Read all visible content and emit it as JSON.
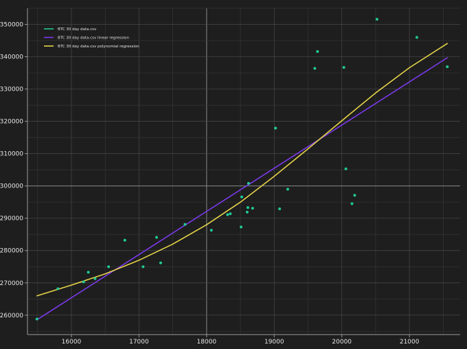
{
  "chart_data": {
    "type": "scatter",
    "title": "",
    "xlabel": "",
    "ylabel": "",
    "xlim": [
      15350,
      21750
    ],
    "ylim": [
      254000,
      355000
    ],
    "x_ticks": [
      16000,
      17000,
      18000,
      19000,
      20000,
      21000
    ],
    "y_ticks": [
      260000,
      270000,
      280000,
      290000,
      300000,
      310000,
      320000,
      330000,
      340000,
      350000
    ],
    "highlight_gridlines": {
      "x": 18000,
      "y": 300000
    },
    "grid": true,
    "legend_position": "top-left",
    "background_color": "#1e1e1e",
    "series": [
      {
        "name": "BTC 30 day data.csv",
        "kind": "scatter",
        "color": "#20c997",
        "points": [
          [
            15490,
            258800
          ],
          [
            15800,
            268200
          ],
          [
            16180,
            270300
          ],
          [
            16250,
            273300
          ],
          [
            16350,
            271300
          ],
          [
            16550,
            275000
          ],
          [
            16790,
            283200
          ],
          [
            17060,
            275000
          ],
          [
            17260,
            284100
          ],
          [
            17320,
            276200
          ],
          [
            17680,
            288100
          ],
          [
            18070,
            286300
          ],
          [
            18310,
            291100
          ],
          [
            18350,
            291400
          ],
          [
            18510,
            287300
          ],
          [
            18520,
            296600
          ],
          [
            18600,
            291900
          ],
          [
            18610,
            293300
          ],
          [
            18620,
            300800
          ],
          [
            18680,
            293100
          ],
          [
            19020,
            317900
          ],
          [
            19080,
            292900
          ],
          [
            19200,
            299000
          ],
          [
            19600,
            336400
          ],
          [
            19640,
            341600
          ],
          [
            20030,
            336700
          ],
          [
            20060,
            305300
          ],
          [
            20150,
            294500
          ],
          [
            20190,
            297100
          ],
          [
            20520,
            351600
          ],
          [
            21110,
            346000
          ],
          [
            21560,
            336900
          ]
        ]
      },
      {
        "name": "BTC 30 day data.csv linear regression",
        "kind": "line",
        "color": "#7c3aed",
        "points": [
          [
            15490,
            258600
          ],
          [
            21560,
            339700
          ]
        ]
      },
      {
        "name": "BTC 30 day data.csv polynomial regression",
        "kind": "line",
        "color": "#e6d44a",
        "points": [
          [
            15490,
            266000
          ],
          [
            16000,
            269300
          ],
          [
            16500,
            272800
          ],
          [
            17000,
            277000
          ],
          [
            17500,
            282000
          ],
          [
            18000,
            288000
          ],
          [
            18500,
            295000
          ],
          [
            19000,
            303000
          ],
          [
            19500,
            311500
          ],
          [
            20000,
            320200
          ],
          [
            20500,
            328800
          ],
          [
            21000,
            336600
          ],
          [
            21560,
            344100
          ]
        ]
      }
    ]
  }
}
